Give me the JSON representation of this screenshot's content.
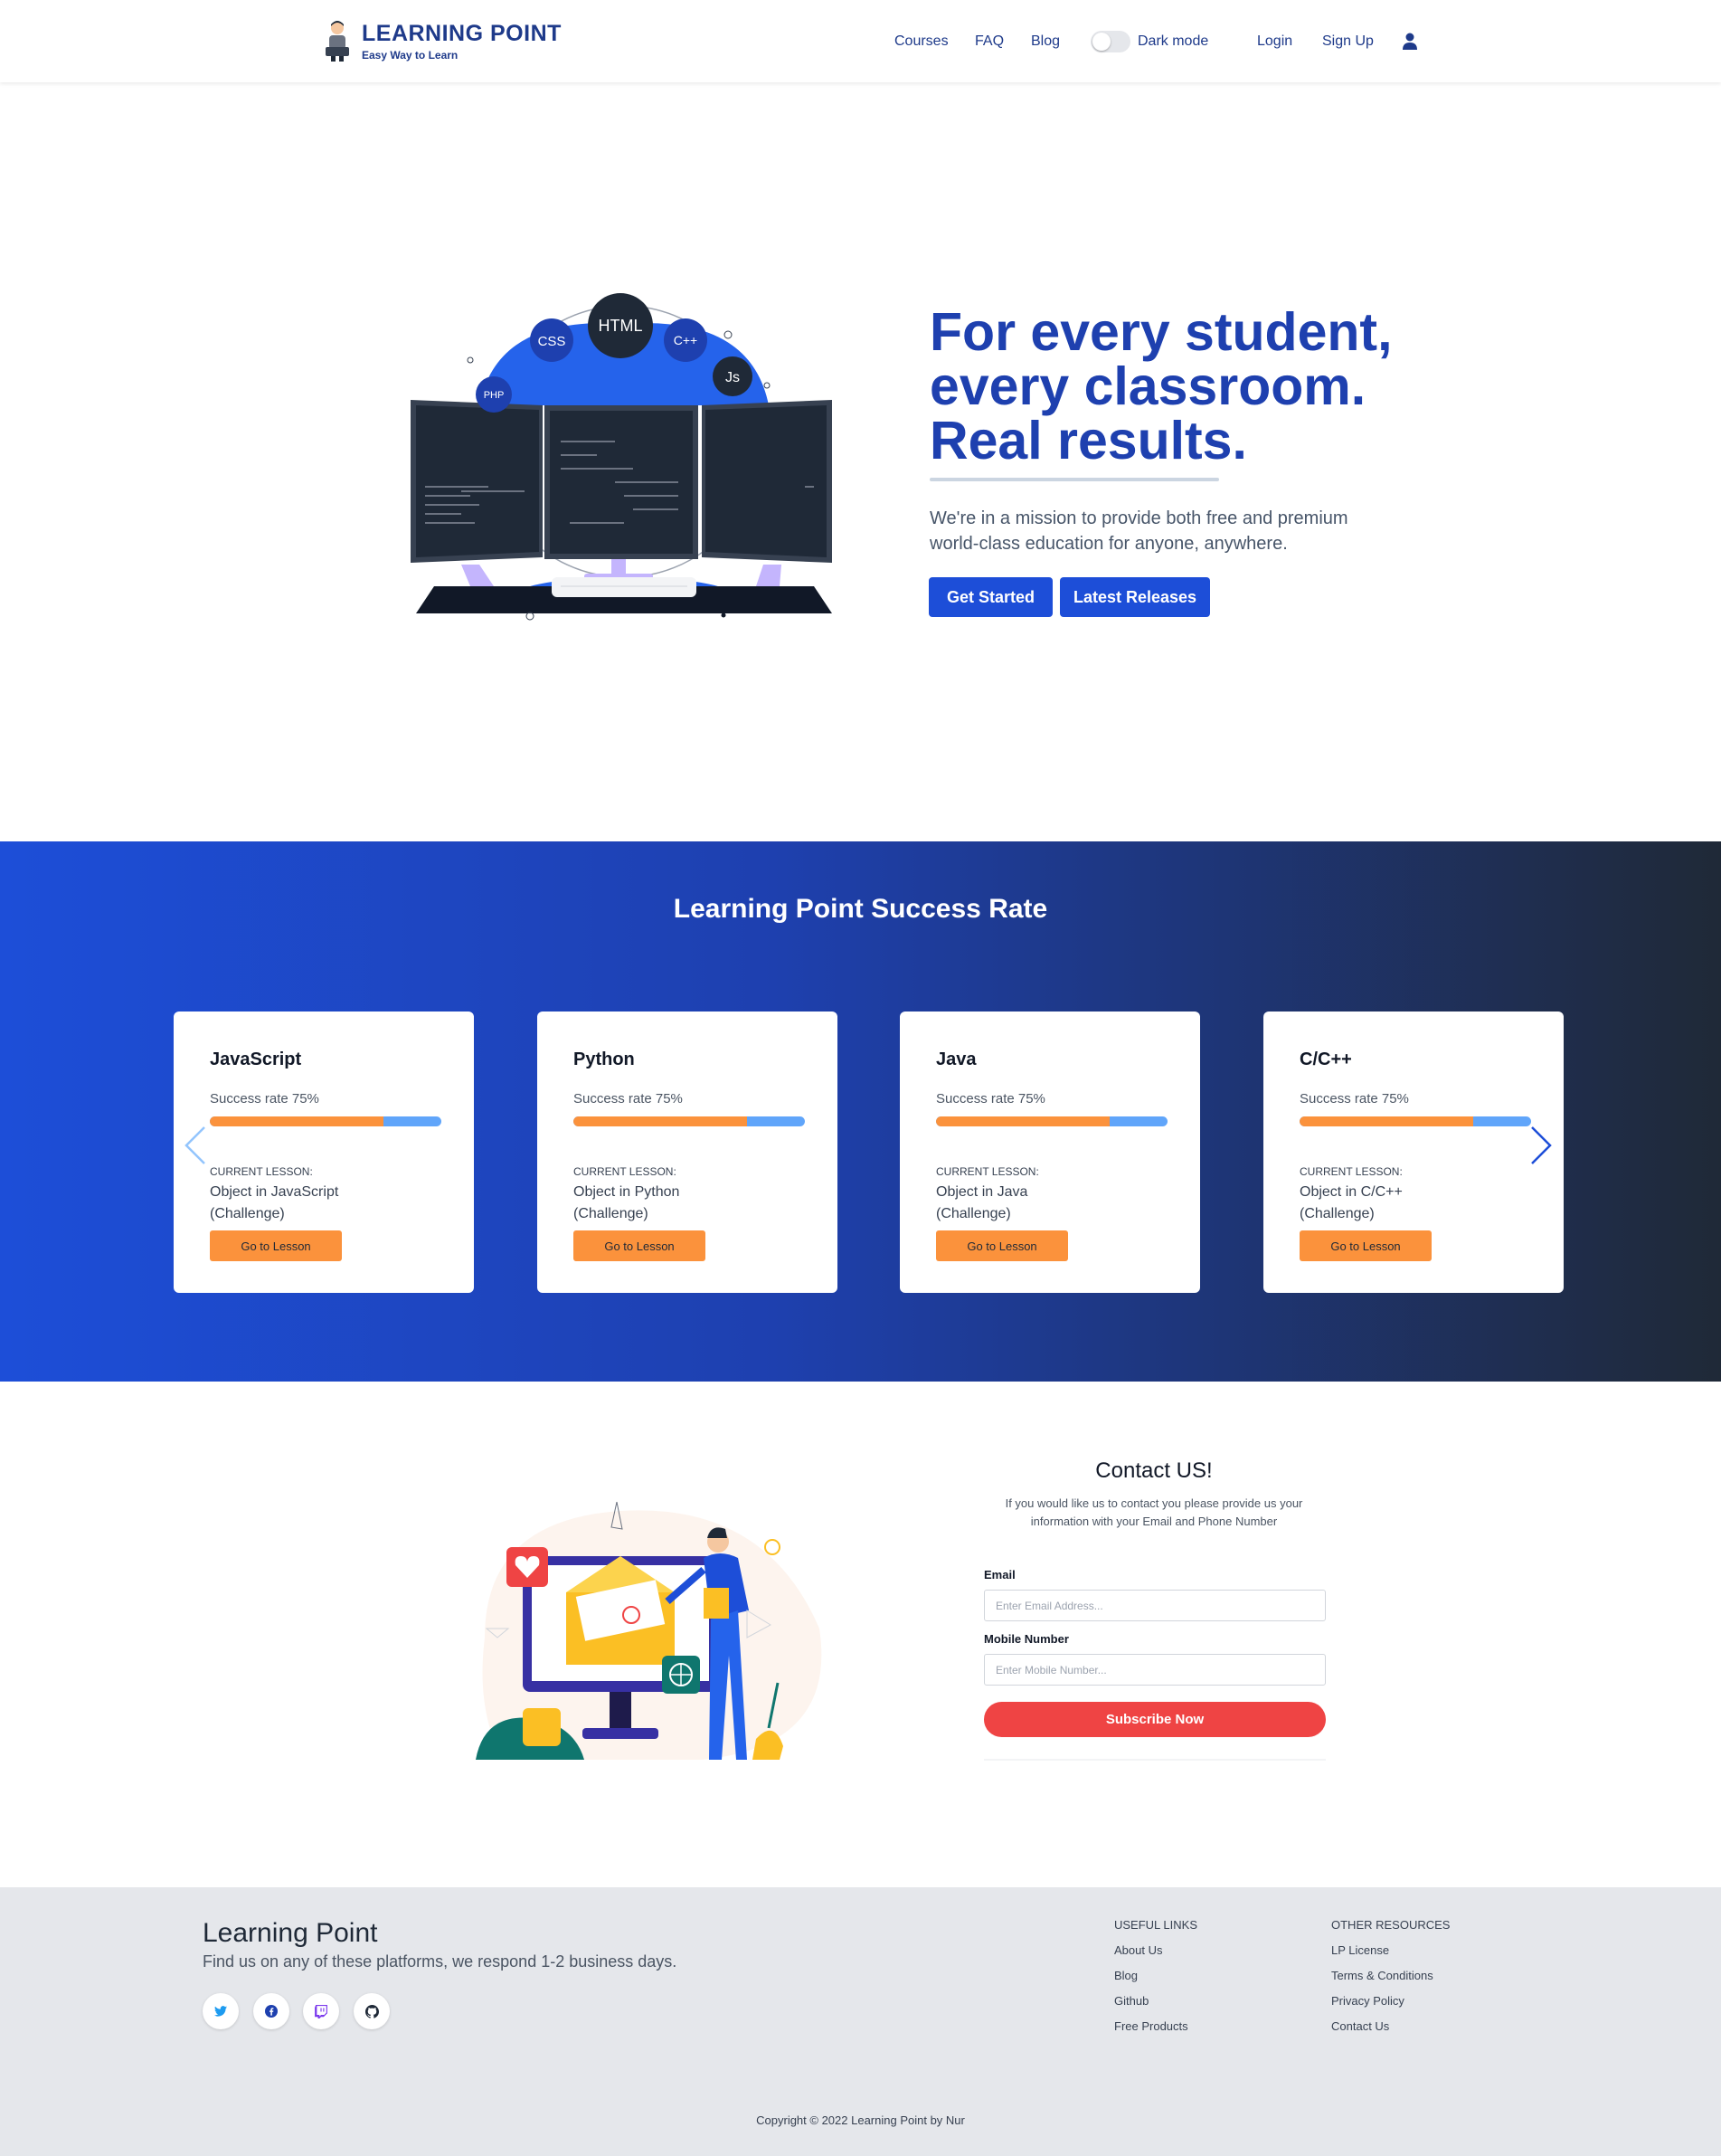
{
  "brand": {
    "title": "LEARNING POINT",
    "subtitle": "Easy Way to Learn"
  },
  "nav": {
    "courses": "Courses",
    "faq": "FAQ",
    "blog": "Blog",
    "dark_mode": "Dark mode",
    "login": "Login",
    "signup": "Sign Up",
    "dark_mode_on": false
  },
  "hero": {
    "title_line1": "For every student,",
    "title_line2": "every classroom.",
    "title_line3": "Real results.",
    "desc_line1": "We're in a mission to provide both free and premium",
    "desc_line2": "world-class education for anyone, anywhere.",
    "btn_get_started": "Get Started",
    "btn_latest": "Latest Releases",
    "illus_labels": {
      "html": "HTML",
      "css": "CSS",
      "cpp": "C++",
      "js": "Js",
      "php": "PHP"
    }
  },
  "success": {
    "title": "Learning Point Success Rate",
    "cards": [
      {
        "lang": "JavaScript",
        "rate_text": "Success rate 75%",
        "rate": 0.75,
        "current_label": "CURRENT LESSON:",
        "lesson_line1": "Object in JavaScript",
        "lesson_line2": "(Challenge)",
        "button": "Go to Lesson"
      },
      {
        "lang": "Python",
        "rate_text": "Success rate 75%",
        "rate": 0.75,
        "current_label": "CURRENT LESSON:",
        "lesson_line1": "Object in Python",
        "lesson_line2": "(Challenge)",
        "button": "Go to Lesson"
      },
      {
        "lang": "Java",
        "rate_text": "Success rate 75%",
        "rate": 0.75,
        "current_label": "CURRENT LESSON:",
        "lesson_line1": "Object in Java",
        "lesson_line2": "(Challenge)",
        "button": "Go to Lesson"
      },
      {
        "lang": "C/C++",
        "rate_text": "Success rate 75%",
        "rate": 0.75,
        "current_label": "CURRENT LESSON:",
        "lesson_line1": "Object in C/C++",
        "lesson_line2": "(Challenge)",
        "button": "Go to Lesson"
      }
    ]
  },
  "contact": {
    "title": "Contact US!",
    "desc_line1": "If you would like us to contact you please provide us your",
    "desc_line2": "information with your Email and Phone Number",
    "email_label": "Email",
    "email_placeholder": "Enter Email Address...",
    "mobile_label": "Mobile Number",
    "mobile_placeholder": "Enter Mobile Number...",
    "subscribe": "Subscribe Now"
  },
  "footer": {
    "title": "Learning Point",
    "subtitle": "Find us on any of these platforms, we respond 1-2 business days.",
    "socials": [
      "twitter-icon",
      "facebook-icon",
      "twitch-icon",
      "github-icon"
    ],
    "useful_links_head": "USEFUL LINKS",
    "useful_links": [
      "About Us",
      "Blog",
      "Github",
      "Free Products"
    ],
    "other_resources_head": "OTHER RESOURCES",
    "other_resources": [
      "LP License",
      "Terms & Conditions",
      "Privacy Policy",
      "Contact Us"
    ],
    "copyright": "Copyright © 2022 Learning Point by Nur"
  },
  "colors": {
    "brand_blue": "#1e3a8a",
    "primary": "#1d4ed8",
    "orange": "#fb923c",
    "bar_blue": "#60a5fa",
    "subscribe_red": "#ef4444",
    "footer_bg": "#e5e7eb"
  }
}
